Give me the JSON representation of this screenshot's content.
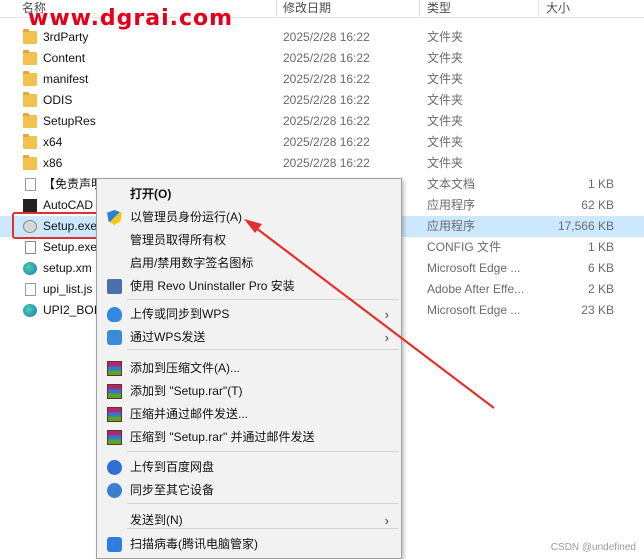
{
  "watermark": "www.dgrai.com",
  "header": {
    "name": "名称",
    "date": "修改日期",
    "type": "类型",
    "size": "大小"
  },
  "files": [
    {
      "name": "3rdParty",
      "date": "2025/2/28 16:22",
      "type": "文件夹",
      "size": "",
      "icon": "folder-icon"
    },
    {
      "name": "Content",
      "date": "2025/2/28 16:22",
      "type": "文件夹",
      "size": "",
      "icon": "folder-icon"
    },
    {
      "name": "manifest",
      "date": "2025/2/28 16:22",
      "type": "文件夹",
      "size": "",
      "icon": "folder-icon"
    },
    {
      "name": "ODIS",
      "date": "2025/2/28 16:22",
      "type": "文件夹",
      "size": "",
      "icon": "folder-icon"
    },
    {
      "name": "SetupRes",
      "date": "2025/2/28 16:22",
      "type": "文件夹",
      "size": "",
      "icon": "folder-icon"
    },
    {
      "name": "x64",
      "date": "2025/2/28 16:22",
      "type": "文件夹",
      "size": "",
      "icon": "folder-icon"
    },
    {
      "name": "x86",
      "date": "2025/2/28 16:22",
      "type": "文件夹",
      "size": "",
      "icon": "folder-icon"
    },
    {
      "name": "【免责声明",
      "date": "",
      "type": "文本文档",
      "size": "1 KB",
      "icon": "text-document-icon"
    },
    {
      "name": "AutoCAD",
      "date": "",
      "type": "应用程序",
      "size": "62 KB",
      "icon": "autocad-app-icon"
    },
    {
      "name": "Setup.exe",
      "date": "",
      "type": "应用程序",
      "size": "17,566 KB",
      "icon": "setup-app-icon"
    },
    {
      "name": "Setup.exe",
      "date": "",
      "type": "CONFIG 文件",
      "size": "1 KB",
      "icon": "config-file-icon"
    },
    {
      "name": "setup.xm",
      "date": "",
      "type": "Microsoft Edge ...",
      "size": "6 KB",
      "icon": "edge-file-icon"
    },
    {
      "name": "upi_list.js",
      "date": "",
      "type": "Adobe After Effe...",
      "size": "2 KB",
      "icon": "js-file-icon"
    },
    {
      "name": "UPI2_BOI",
      "date": "",
      "type": "Microsoft Edge ...",
      "size": "23 KB",
      "icon": "edge-file-icon"
    }
  ],
  "menu": {
    "items": [
      {
        "label": "打开(O)",
        "icon": "",
        "arrow": false,
        "bold": true
      },
      {
        "label": "以管理员身份运行(A)",
        "icon": "uac-shield-icon",
        "arrow": false
      },
      {
        "label": "管理员取得所有权",
        "icon": "",
        "arrow": false
      },
      {
        "label": "启用/禁用数字签名图标",
        "icon": "",
        "arrow": false
      },
      {
        "label": "使用 Revo Uninstaller Pro 安装",
        "icon": "revo-uninstaller-icon",
        "arrow": false
      },
      {
        "label": "上传或同步到WPS",
        "icon": "wps-cloud-icon",
        "arrow": true
      },
      {
        "label": "通过WPS发送",
        "icon": "wps-share-icon",
        "arrow": true
      },
      {
        "label": "添加到压缩文件(A)...",
        "icon": "winrar-icon",
        "arrow": false
      },
      {
        "label": "添加到 \"Setup.rar\"(T)",
        "icon": "winrar-icon",
        "arrow": false
      },
      {
        "label": "压缩并通过邮件发送...",
        "icon": "winrar-icon",
        "arrow": false
      },
      {
        "label": "压缩到 \"Setup.rar\" 并通过邮件发送",
        "icon": "winrar-icon",
        "arrow": false
      },
      {
        "label": "上传到百度网盘",
        "icon": "baidu-netdisk-icon",
        "arrow": false
      },
      {
        "label": "同步至其它设备",
        "icon": "sync-devices-icon",
        "arrow": false
      },
      {
        "label": "发送到(N)",
        "icon": "",
        "arrow": true
      },
      {
        "label": "扫描病毒(腾讯电脑管家)",
        "icon": "tencent-pc-manager-icon",
        "arrow": false
      }
    ]
  },
  "footer": "CSDN @undefined"
}
